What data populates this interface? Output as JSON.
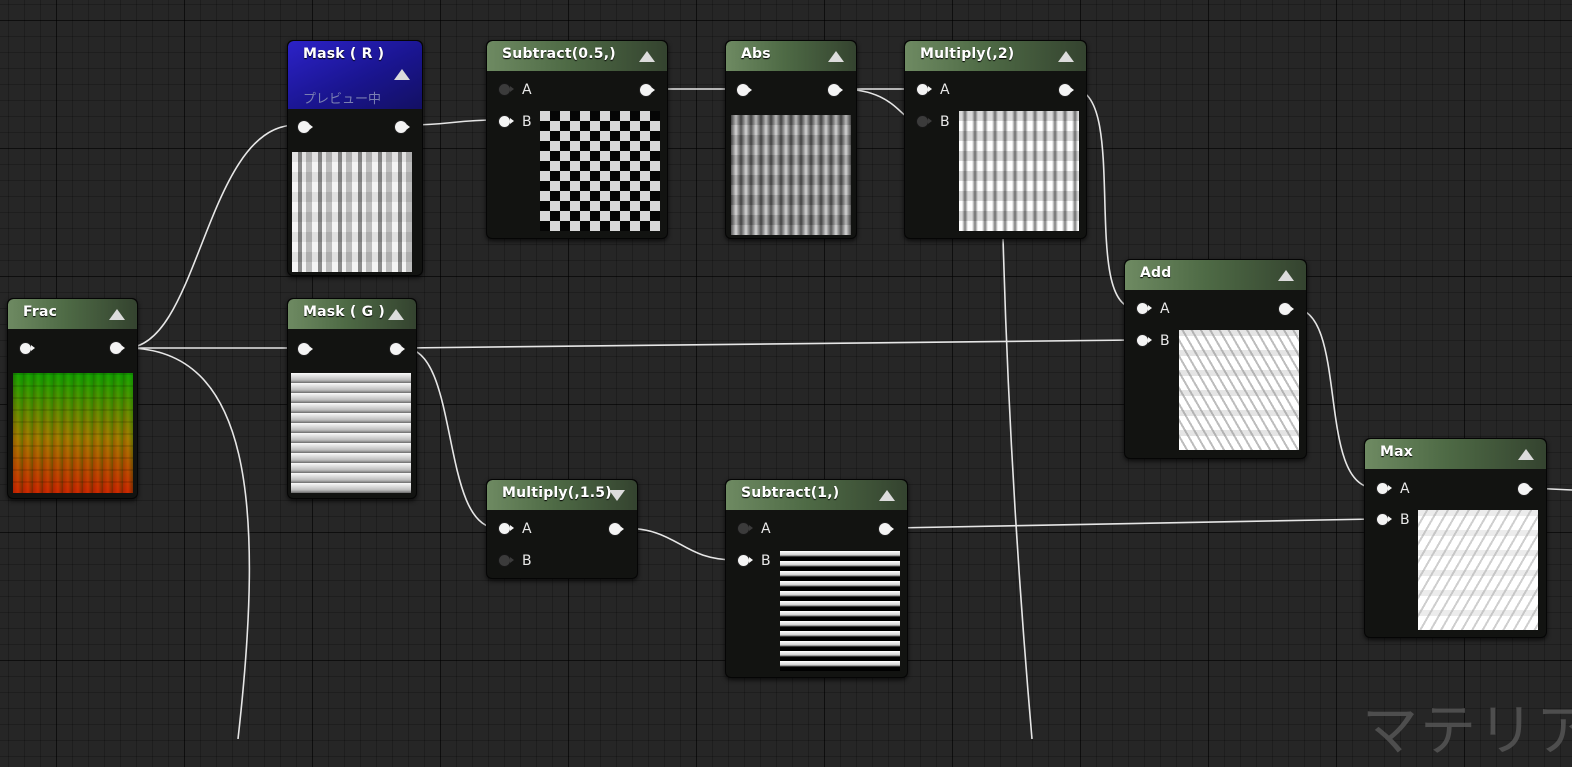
{
  "nodes": {
    "frac": {
      "title": "Frac"
    },
    "mask_r": {
      "title": "Mask ( R )",
      "subtitle": "プレビュー中"
    },
    "mask_g": {
      "title": "Mask ( G )"
    },
    "subtract_half": {
      "title": "Subtract(0.5,)",
      "pin_a": "A",
      "pin_b": "B"
    },
    "abs": {
      "title": "Abs"
    },
    "multiply_2": {
      "title": "Multiply(,2)",
      "pin_a": "A",
      "pin_b": "B"
    },
    "add": {
      "title": "Add",
      "pin_a": "A",
      "pin_b": "B"
    },
    "multiply_15": {
      "title": "Multiply(,1.5)",
      "pin_a": "A",
      "pin_b": "B"
    },
    "subtract_1": {
      "title": "Subtract(1,)",
      "pin_a": "A",
      "pin_b": "B"
    },
    "max": {
      "title": "Max",
      "pin_a": "A",
      "pin_b": "B"
    }
  },
  "watermark": "マテリア",
  "colors": {
    "canvas": "#262626",
    "node_header_green": "#6e8a62",
    "node_header_selected": "#2c22c8",
    "wire": "#e6e6e6"
  },
  "icons": {
    "collapse": "triangle-up-icon",
    "expand": "triangle-down-icon",
    "pin": "exec-pin-icon"
  }
}
